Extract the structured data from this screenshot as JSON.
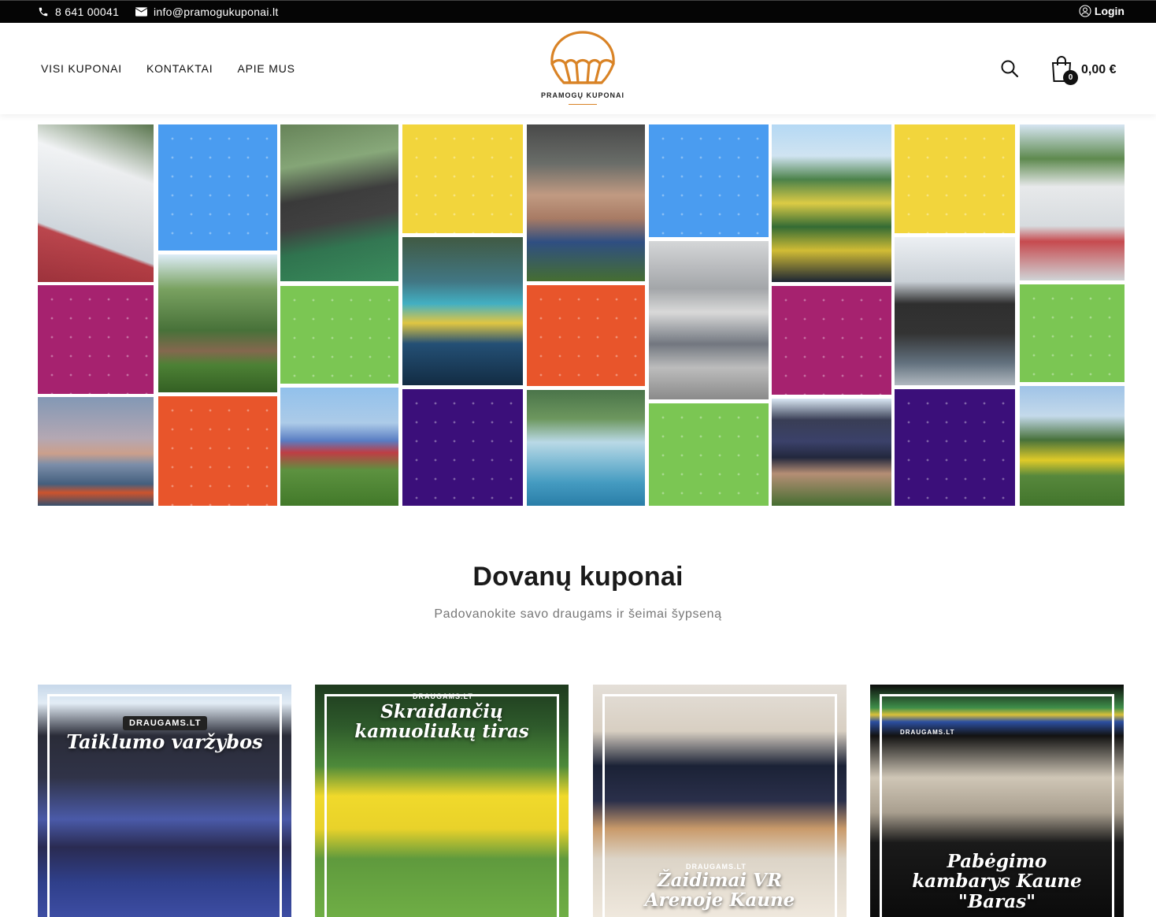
{
  "topbar": {
    "phone": "8 641 00041",
    "email": "info@pramogukuponai.lt",
    "login": "Login",
    "icons": [
      "phone-icon",
      "envelope-icon",
      "user-icon"
    ]
  },
  "nav": {
    "items": [
      {
        "label": "VISI KUPONAI"
      },
      {
        "label": "KONTAKTAI"
      },
      {
        "label": "APIE MUS"
      }
    ]
  },
  "logo": {
    "text": "PRAMOGŲ KUPONAI",
    "accent": "#d98326"
  },
  "cart": {
    "count": "0",
    "total": "0,00 €"
  },
  "mosaic": {
    "colors": {
      "blue": "#4a9cf0",
      "yellow": "#f2d53c",
      "magenta": "#a6226f",
      "green": "#7bc653",
      "orange": "#e8552b",
      "purple": "#3b0f7a"
    }
  },
  "section": {
    "title": "Dovanų kuponai",
    "subtitle": "Padovanokite savo draugams ir šeimai šypseną"
  },
  "cards": [
    {
      "title": "Taiklumo varžybos",
      "badge": "DRAUGAMS.LT"
    },
    {
      "title": "Skraidančių kamuoliukų tiras",
      "badge": "DRAUGAMS.LT"
    },
    {
      "title": "Žaidimai VR Arenoje Kaune",
      "badge": "DRAUGAMS.LT"
    },
    {
      "title": "Pabėgimo kambarys Kaune \"Baras\"",
      "badge": "DRAUGAMS.LT"
    }
  ]
}
